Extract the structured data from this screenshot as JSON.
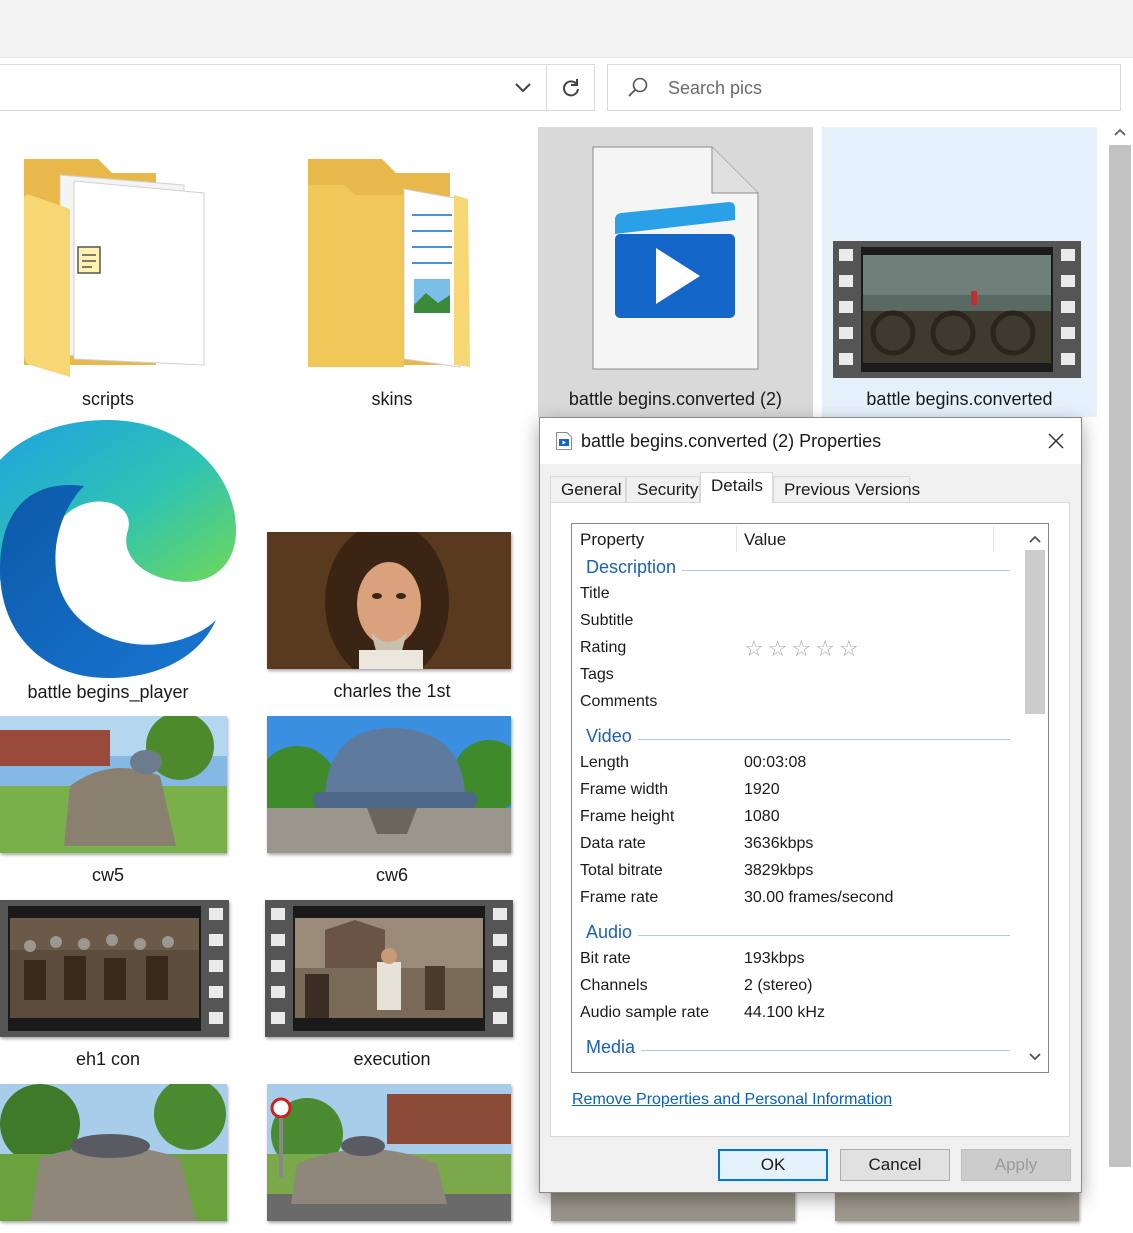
{
  "explorer": {
    "search_placeholder": "Search pics",
    "address_dropdown_icon": "chevron-down-icon",
    "refresh_icon": "refresh-icon",
    "items": [
      {
        "label": "scripts",
        "kind": "folder"
      },
      {
        "label": "skins",
        "kind": "folder"
      },
      {
        "label": "battle begins.converted (2)",
        "kind": "video-file"
      },
      {
        "label": "battle begins.converted",
        "kind": "video"
      },
      {
        "label": "battle begins_player",
        "kind": "edge-app"
      },
      {
        "label": "charles the 1st",
        "kind": "image"
      },
      {
        "label": "cw5",
        "kind": "image"
      },
      {
        "label": "cw6",
        "kind": "image"
      },
      {
        "label": "eh1 con",
        "kind": "video"
      },
      {
        "label": "execution",
        "kind": "video"
      }
    ]
  },
  "dialog": {
    "title": "battle begins.converted (2) Properties",
    "tabs": [
      "General",
      "Security",
      "Details",
      "Previous Versions"
    ],
    "active_tab": "Details",
    "columns": {
      "property": "Property",
      "value": "Value"
    },
    "sections": {
      "description": "Description",
      "video": "Video",
      "audio": "Audio",
      "media": "Media"
    },
    "description_rows": [
      {
        "name": "Title",
        "value": ""
      },
      {
        "name": "Subtitle",
        "value": ""
      },
      {
        "name": "Rating",
        "value": ""
      },
      {
        "name": "Tags",
        "value": ""
      },
      {
        "name": "Comments",
        "value": ""
      }
    ],
    "rating_stars": 0,
    "rating_max": 5,
    "video_rows": [
      {
        "name": "Length",
        "value": "00:03:08"
      },
      {
        "name": "Frame width",
        "value": "1920"
      },
      {
        "name": "Frame height",
        "value": "1080"
      },
      {
        "name": "Data rate",
        "value": "3636kbps"
      },
      {
        "name": "Total bitrate",
        "value": "3829kbps"
      },
      {
        "name": "Frame rate",
        "value": "30.00 frames/second"
      }
    ],
    "audio_rows": [
      {
        "name": "Bit rate",
        "value": "193kbps"
      },
      {
        "name": "Channels",
        "value": "2 (stereo)"
      },
      {
        "name": "Audio sample rate",
        "value": "44.100 kHz"
      }
    ],
    "remove_link": "Remove Properties and Personal Information",
    "buttons": {
      "ok": "OK",
      "cancel": "Cancel",
      "apply": "Apply"
    }
  },
  "colors": {
    "selection_gray": "#d9d9d9",
    "selection_blue": "#e5f1fb",
    "section_blue": "#1c5fb8",
    "link_blue": "#0a5fbf",
    "folder_yellow": "#f7d774"
  }
}
